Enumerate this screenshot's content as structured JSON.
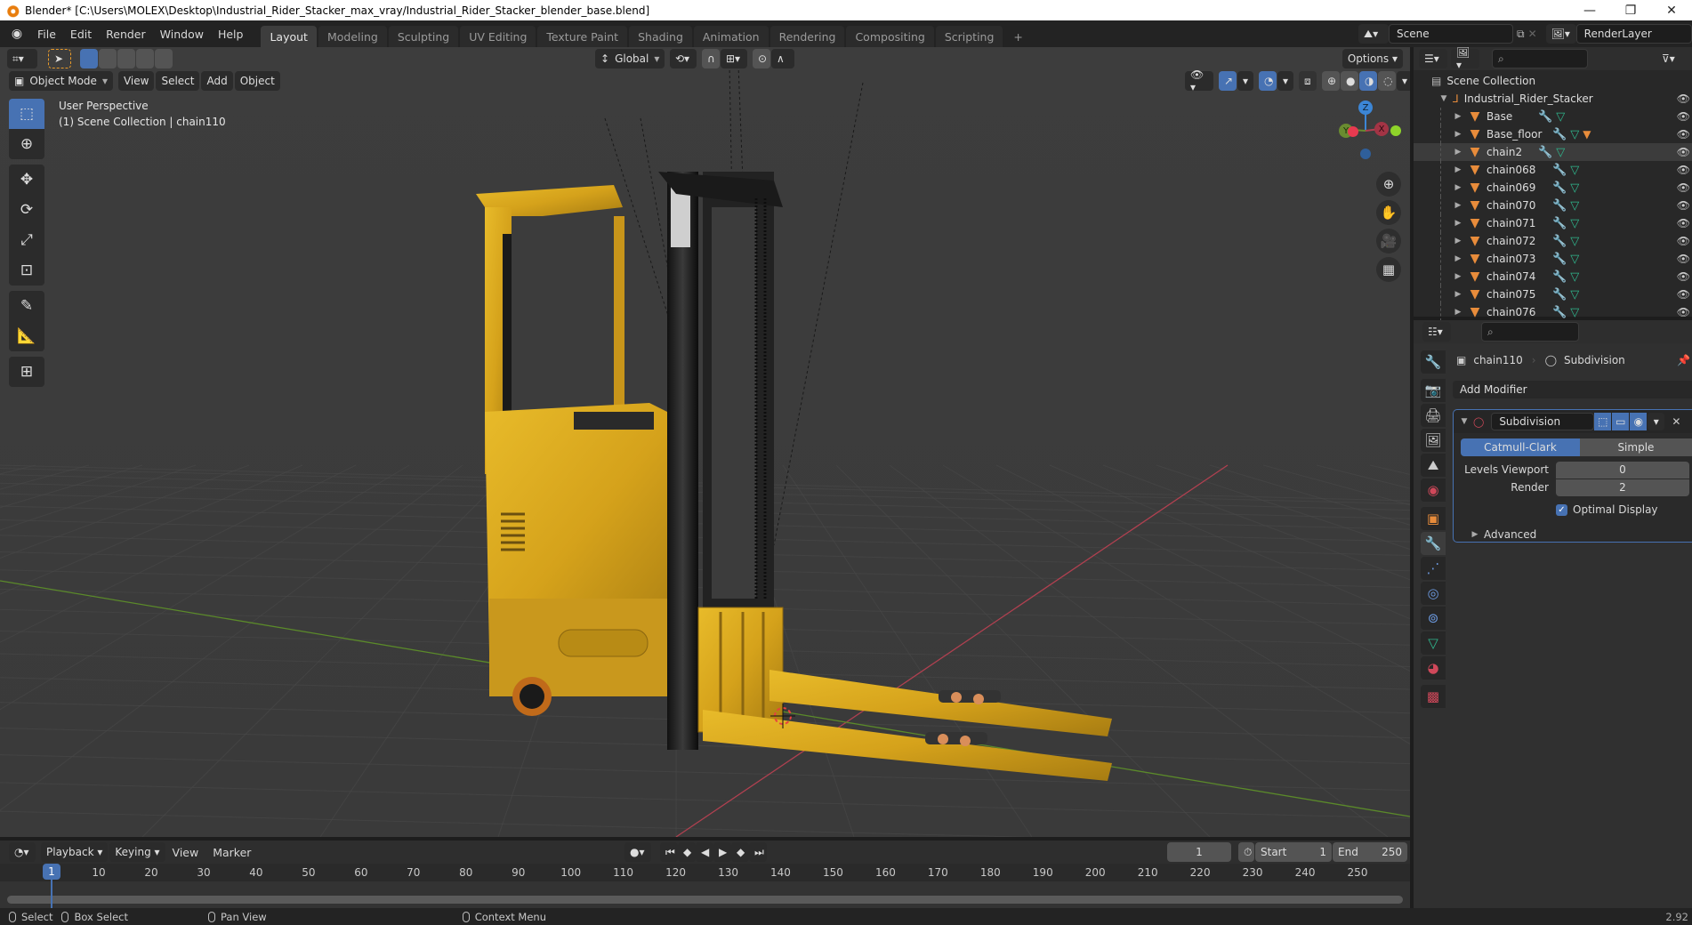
{
  "window": {
    "title": "Blender* [C:\\Users\\MOLEX\\Desktop\\Industrial_Rider_Stacker_max_vray/Industrial_Rider_Stacker_blender_base.blend]",
    "minimize": "—",
    "restore": "❐",
    "close": "✕"
  },
  "menu": {
    "items": [
      "File",
      "Edit",
      "Render",
      "Window",
      "Help"
    ]
  },
  "workspaces": {
    "tabs": [
      "Layout",
      "Modeling",
      "Sculpting",
      "UV Editing",
      "Texture Paint",
      "Shading",
      "Animation",
      "Rendering",
      "Compositing",
      "Scripting"
    ],
    "active": "Layout",
    "add": "+"
  },
  "scene": {
    "name": "Scene",
    "view_layer": "RenderLayer"
  },
  "viewport": {
    "mode": "Object Mode",
    "menus": [
      "View",
      "Select",
      "Add",
      "Object"
    ],
    "transform_orientation": "Global",
    "options_label": "Options",
    "info_line1": "User Perspective",
    "info_line2": "(1) Scene Collection | chain110",
    "gizmo_axes": {
      "z": "Z",
      "y": "Y",
      "x": "X"
    },
    "colors": {
      "x_axis": "#d53c50",
      "y_axis": "#8bc53f",
      "z_axis": "#3c86d6",
      "accent": "#4772b3",
      "object_yellow": "#d9a91e"
    }
  },
  "tools": [
    "select-box",
    "cursor",
    "move",
    "rotate",
    "scale",
    "transform",
    "annotate",
    "measure",
    "add-cube"
  ],
  "outliner": {
    "root": "Scene Collection",
    "collection": "Industrial_Rider_Stacker",
    "objects": [
      {
        "name": "Base",
        "extra_material": false,
        "selected": false
      },
      {
        "name": "Base_floor",
        "extra_material": true,
        "selected": false
      },
      {
        "name": "chain2",
        "extra_material": false,
        "selected": true
      },
      {
        "name": "chain068",
        "extra_material": false,
        "selected": false
      },
      {
        "name": "chain069",
        "extra_material": false,
        "selected": false
      },
      {
        "name": "chain070",
        "extra_material": false,
        "selected": false
      },
      {
        "name": "chain071",
        "extra_material": false,
        "selected": false
      },
      {
        "name": "chain072",
        "extra_material": false,
        "selected": false
      },
      {
        "name": "chain073",
        "extra_material": false,
        "selected": false
      },
      {
        "name": "chain074",
        "extra_material": false,
        "selected": false
      },
      {
        "name": "chain075",
        "extra_material": false,
        "selected": false
      },
      {
        "name": "chain076",
        "extra_material": false,
        "selected": false
      }
    ]
  },
  "properties": {
    "breadcrumb_object": "chain110",
    "breadcrumb_modifier": "Subdivision",
    "add_modifier": "Add Modifier",
    "modifier": {
      "name": "Subdivision",
      "types": [
        "Catmull-Clark",
        "Simple"
      ],
      "active_type": "Catmull-Clark",
      "levels_viewport_label": "Levels Viewport",
      "levels_viewport": "0",
      "render_label": "Render",
      "render": "2",
      "optimal_display_label": "Optimal Display",
      "optimal_display": true,
      "advanced_label": "Advanced"
    },
    "tabs": [
      "tool",
      "render",
      "output",
      "view-layer",
      "scene",
      "world",
      "object",
      "modifiers",
      "particles",
      "physics",
      "constraints",
      "data",
      "material",
      "texture"
    ],
    "active_tab": "modifiers"
  },
  "timeline": {
    "menus": [
      "Playback",
      "Keying",
      "View",
      "Marker"
    ],
    "current_frame": "1",
    "start_label": "Start",
    "start": "1",
    "end_label": "End",
    "end": "250",
    "ticks": [
      "10",
      "20",
      "30",
      "40",
      "50",
      "60",
      "70",
      "80",
      "90",
      "100",
      "110",
      "120",
      "130",
      "140",
      "150",
      "160",
      "170",
      "180",
      "190",
      "200",
      "210",
      "220",
      "230",
      "240",
      "250"
    ],
    "playhead": "1"
  },
  "statusbar": {
    "select": "Select",
    "box_select": "Box Select",
    "pan_view": "Pan View",
    "context_menu": "Context Menu",
    "version": "2.92"
  }
}
